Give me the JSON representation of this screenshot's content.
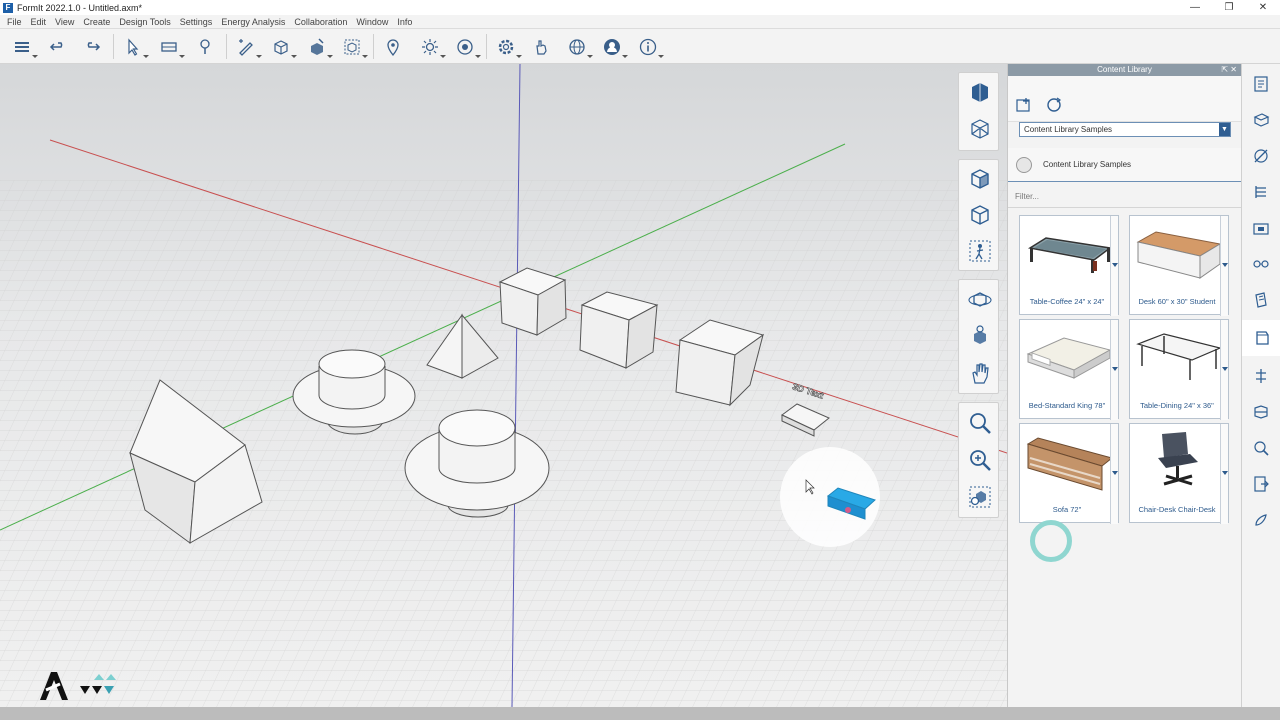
{
  "window": {
    "title": "FormIt 2022.1.0 - Untitled.axm*",
    "controls": [
      "—",
      "❐",
      "✕"
    ]
  },
  "menu": [
    "File",
    "Edit",
    "View",
    "Create",
    "Design Tools",
    "Settings",
    "Energy Analysis",
    "Collaboration",
    "Window",
    "Info"
  ],
  "toolbar": {
    "tools": [
      "layers-icon",
      "undo-icon",
      "redo-icon",
      "select-icon",
      "group-icon",
      "paint-icon",
      "sketch-icon",
      "cube-add-icon",
      "cube-edit-icon",
      "cube-select-icon",
      "pin-icon",
      "sun-icon",
      "render-icon",
      "settings-icon",
      "hand-icon",
      "globe-icon",
      "user-icon",
      "info-icon"
    ]
  },
  "viewtools": {
    "groups": [
      [
        "view-cube-icon",
        "perspective-icon"
      ],
      [
        "front-view-icon",
        "iso-view-icon",
        "walk-icon"
      ],
      [
        "orbit-icon",
        "look-around-icon",
        "pan-icon"
      ],
      [
        "zoom-icon",
        "zoom-in-icon",
        "zoom-extents-icon"
      ]
    ]
  },
  "viewport": {
    "label_3d_text": "3D Text"
  },
  "content_library": {
    "header": "Content Library",
    "header_buttons": "⇱  ✕",
    "dropdown_value": "Content Library Samples",
    "dropdown_arrow": "▼",
    "library_name": "Content Library Samples",
    "filter_placeholder": "Filter...",
    "items": [
      {
        "name": "Table-Coffee 24\" x 24\""
      },
      {
        "name": "Desk 60\" x 30\" Student"
      },
      {
        "name": "Bed-Standard King 78\""
      },
      {
        "name": "Table-Dining 24\" x 36\""
      },
      {
        "name": "Sofa 72\""
      },
      {
        "name": "Chair-Desk Chair-Desk"
      }
    ]
  },
  "sidebar": {
    "icons": [
      "properties-icon",
      "materials-icon",
      "sketch-props-icon",
      "levels-icon",
      "scenes-icon",
      "groups-icon",
      "visual-styles-icon",
      "content-library-icon",
      "plugins-icon",
      "dynamo-icon",
      "analysis-icon",
      "export-icon",
      "paint-icon"
    ],
    "active": "content-library-icon"
  },
  "colors": {
    "accent": "#2f5e92",
    "selected_object": "#29a9e6",
    "axis_red": "#c85050",
    "axis_green": "#4caf4c",
    "axis_blue": "#4a4aa8"
  }
}
